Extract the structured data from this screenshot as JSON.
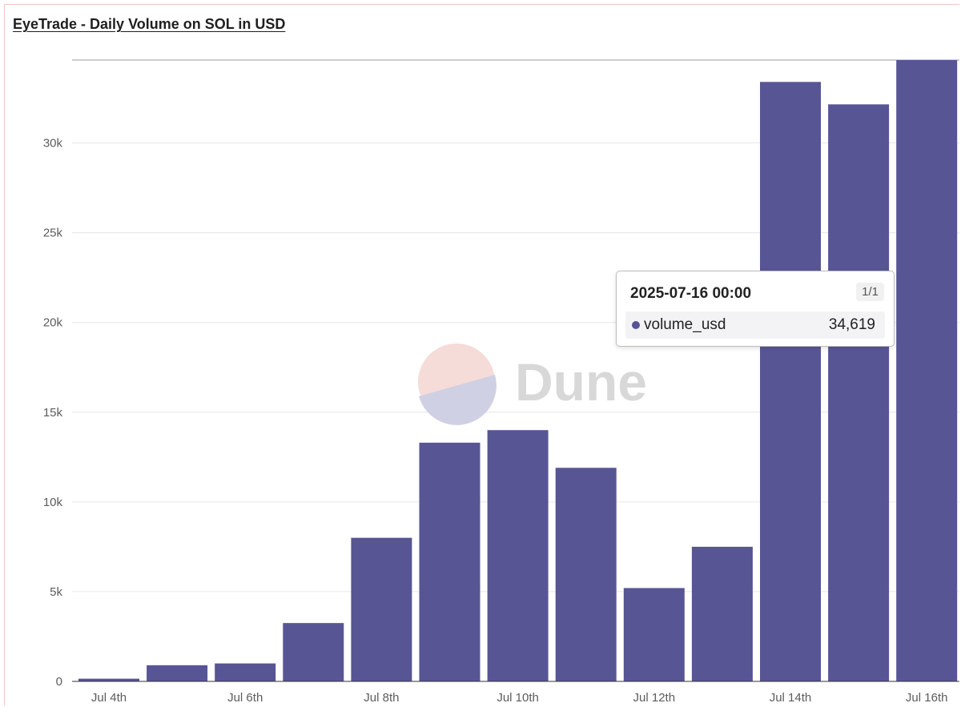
{
  "title": "EyeTrade - Daily Volume on SOL in USD",
  "watermark": "Dune",
  "colors": {
    "bar": "#585595",
    "grid": "#e6e6e6",
    "axis": "#333333"
  },
  "tooltip": {
    "title": "2025-07-16 00:00",
    "page": "1/1",
    "series_name": "volume_usd",
    "value": "34,619"
  },
  "chart_data": {
    "type": "bar",
    "categories": [
      "2025-07-04",
      "2025-07-05",
      "2025-07-06",
      "2025-07-07",
      "2025-07-08",
      "2025-07-09",
      "2025-07-10",
      "2025-07-11",
      "2025-07-12",
      "2025-07-13",
      "2025-07-14",
      "2025-07-15",
      "2025-07-16"
    ],
    "x_tick_labels": [
      "Jul 4th",
      "Jul 6th",
      "Jul 8th",
      "Jul 10th",
      "Jul 12th",
      "Jul 14th",
      "Jul 16th"
    ],
    "x_tick_indices": [
      0,
      2,
      4,
      6,
      8,
      10,
      12
    ],
    "y_ticks": [
      0,
      5000,
      10000,
      15000,
      20000,
      25000,
      30000
    ],
    "y_tick_labels": [
      "0",
      "5k",
      "10k",
      "15k",
      "20k",
      "25k",
      "30k"
    ],
    "ylim": [
      0,
      34619
    ],
    "series": [
      {
        "name": "volume_usd",
        "values": [
          150,
          900,
          1000,
          3250,
          8000,
          13300,
          14000,
          11900,
          5200,
          7500,
          33400,
          32150,
          34619
        ]
      }
    ],
    "grid": true
  }
}
